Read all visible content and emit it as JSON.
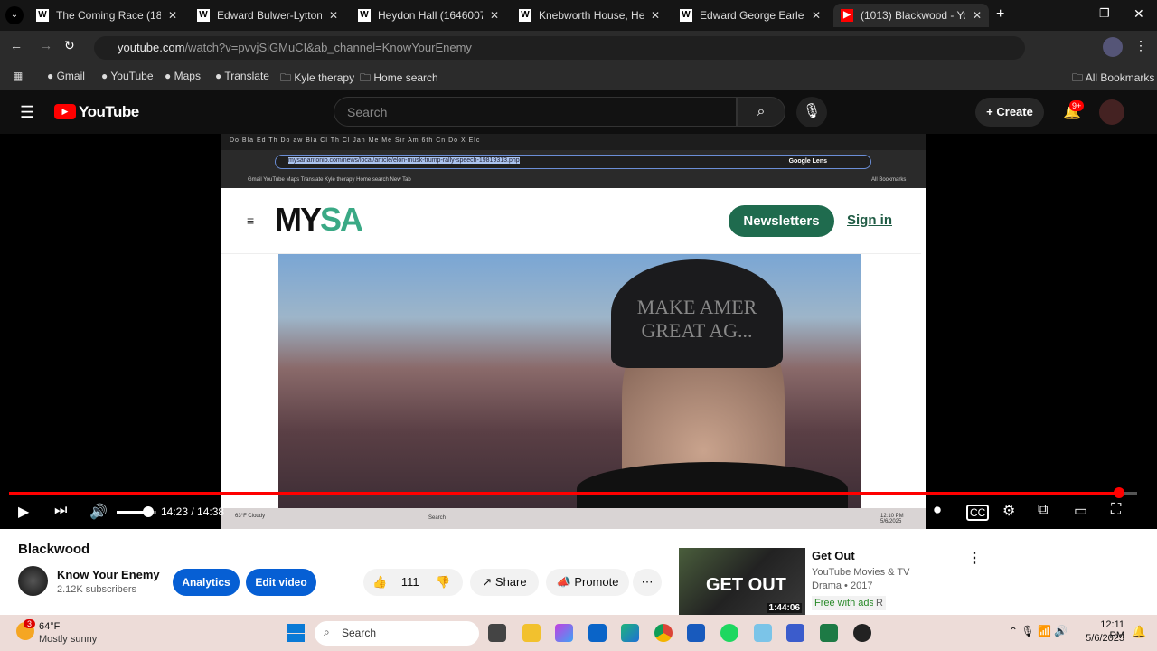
{
  "browser": {
    "tabs": [
      {
        "title": "The Coming Race (1871) -",
        "icon": "wikipedia-icon"
      },
      {
        "title": "Edward Bulwer-Lytton Vani",
        "icon": "wikipedia-icon"
      },
      {
        "title": "Heydon Hall (1646007182",
        "icon": "wikipedia-icon"
      },
      {
        "title": "Knebworth House, Hertfor",
        "icon": "wikipedia-icon"
      },
      {
        "title": "Edward George Earle Lytto",
        "icon": "wikipedia-icon"
      },
      {
        "title": "(1013) Blackwood - Yo",
        "icon": "youtube-icon",
        "active": true
      }
    ],
    "url_host": "youtube.com",
    "url_path": "/watch?v=pvvjSiGMuCI&ab_channel=KnowYourEnemy",
    "bookmarks": [
      "Gmail",
      "YouTube",
      "Maps",
      "Translate",
      "Kyle therapy",
      "Home search"
    ],
    "all_bookmarks": "All Bookmarks"
  },
  "youtube": {
    "logo": "YouTube",
    "search_placeholder": "Search",
    "create": "Create",
    "notifications": "9+"
  },
  "video_content": {
    "inner_tabs": "Do  Bla  Ed  Th  Do  aw  Bla  Cl  Th  Cl  Jan  Me  Me  Sir  Am  6th  Cn  Do  X  Elc",
    "inner_url": "mysanantonio.com/news/local/article/elon-musk-trump-rally-speech-19819313.php",
    "inner_lens": "Google Lens",
    "inner_bookmarks": "Gmail   YouTube   Maps   Translate   Kyle therapy   Home search   New Tab",
    "inner_all_bookmarks": "All Bookmarks",
    "site_logo_a": "MY",
    "site_logo_b": "SA",
    "newsletters": "Newsletters",
    "sign_in": "Sign in",
    "hat_text": "MAKE AMER\nGREAT AG...",
    "inner_weather": "63°F Cloudy",
    "inner_search": "Search",
    "inner_time": "12:10 PM 5/6/2025"
  },
  "player": {
    "time": "14:23 / 14:38",
    "progress": 0.984,
    "volume": 0.8
  },
  "watch": {
    "title": "Blackwood",
    "channel": "Know Your Enemy",
    "subscribers": "2.12K subscribers",
    "analytics": "Analytics",
    "edit_video": "Edit video",
    "likes": "111",
    "share": "Share",
    "promote": "Promote"
  },
  "recommended": {
    "title": "Get Out",
    "channel": "YouTube Movies & TV",
    "meta": "Drama • 2017",
    "badge": "Free with ads",
    "rating": "R",
    "duration": "1:44:06",
    "thumb_text": "GET OUT"
  },
  "taskbar": {
    "weather_temp": "64°F",
    "weather_desc": "Mostly sunny",
    "weather_badge": "3",
    "search": "Search",
    "time": "12:11 PM",
    "date": "5/6/2025"
  }
}
